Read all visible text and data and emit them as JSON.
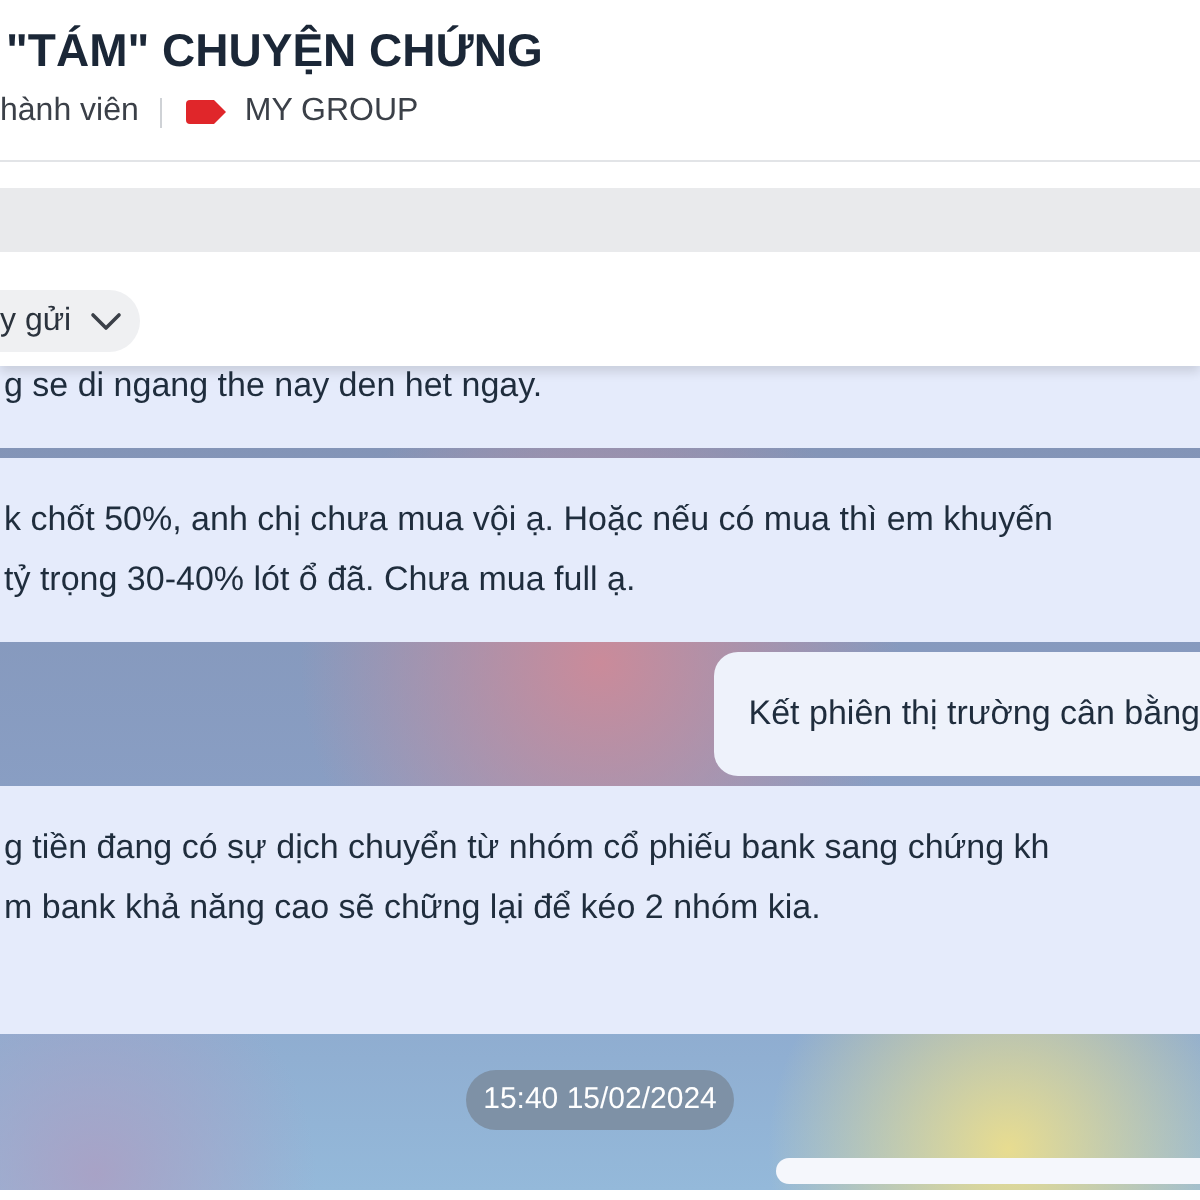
{
  "header": {
    "title": "\"TÁM\" CHUYỆN CHỨNG",
    "member_count": "hành viên",
    "group_label": "MY GROUP"
  },
  "filter": {
    "label": "y gửi"
  },
  "messages": [
    {
      "kind": "received",
      "lines": [
        "g se di ngang the nay den het ngay."
      ]
    },
    {
      "kind": "received",
      "lines": [
        "k chốt 50%, anh chị chưa mua vội ạ. Hoặc nếu có mua thì em khuyến",
        "tỷ trọng 30-40% lót ổ đã. Chưa mua full ạ."
      ]
    },
    {
      "kind": "sent",
      "lines": [
        "Kết phiên thị trường cân bằng"
      ]
    },
    {
      "kind": "received",
      "lines": [
        "g tiền đang có sự dịch chuyển từ nhóm cổ phiếu bank sang chứng kh",
        "m bank khả năng cao sẽ chững lại để kéo 2 nhóm kia."
      ]
    },
    {
      "kind": "timestamp",
      "text": "15:40 15/02/2024"
    },
    {
      "kind": "sent"
    }
  ]
}
